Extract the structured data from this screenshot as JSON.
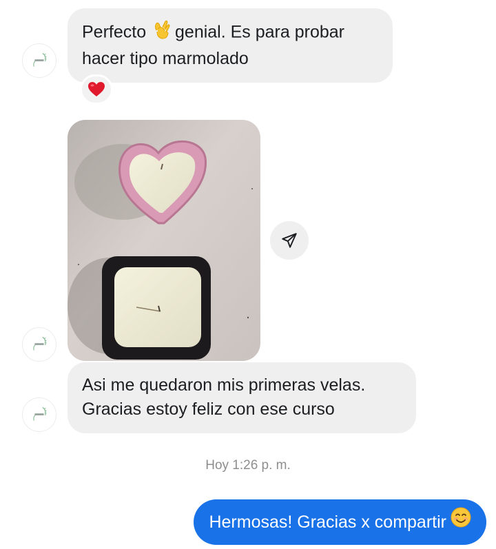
{
  "thread": {
    "messages": [
      {
        "line1_before_emoji": "Perfecto ",
        "emoji": "ok-hand",
        "line1_after_emoji": " genial. Es para probar",
        "line2": "hacer tipo marmolado",
        "reaction": "red-heart"
      },
      {
        "type": "image",
        "description_icon": "candle-photo"
      },
      {
        "line1": "Asi me quedaron mis primeras velas.",
        "line2": "Gracias estoy feliz con ese curso"
      }
    ],
    "timestamp": "Hoy 1:26 p. m.",
    "outgoing": {
      "text": "Hermosas! Gracias x compartir",
      "emoji": "smiling-face"
    }
  },
  "colors": {
    "incoming_bubble": "#efefef",
    "outgoing_bubble": "#1a72e8",
    "timestamp_text": "#8e8e8e"
  }
}
